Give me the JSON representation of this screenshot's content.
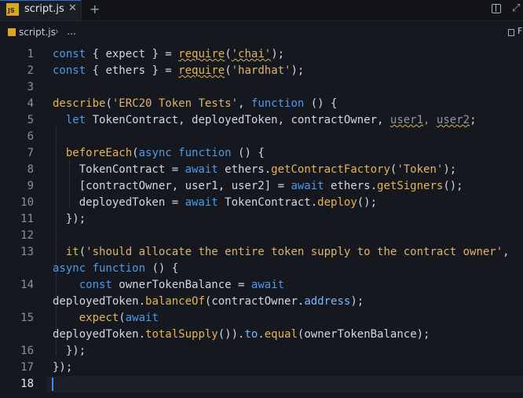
{
  "tab": {
    "icon": "JS",
    "filename": "script.js",
    "close": "✕"
  },
  "toolbar": {
    "new_tab": "+",
    "split_icon": "split-editor-icon",
    "expand": "⤢"
  },
  "breadcrumb": {
    "file": "script.js",
    "sep": "›",
    "more": "…",
    "right": "F"
  },
  "editor": {
    "active_line": 18,
    "lines": [
      {
        "n": "1",
        "t": [
          [
            "kw",
            "const"
          ],
          [
            "",
            "{ expect } = "
          ],
          [
            "fn squig",
            "require"
          ],
          [
            "",
            "("
          ],
          [
            "str squig",
            "'chai'"
          ],
          [
            "",
            ");"
          ]
        ]
      },
      {
        "n": "2",
        "t": [
          [
            "kw",
            "const"
          ],
          [
            "",
            "{ ethers } = "
          ],
          [
            "fn squig",
            "require"
          ],
          [
            "",
            "("
          ],
          [
            "str",
            "'hardhat'"
          ],
          [
            "",
            ");"
          ]
        ]
      },
      {
        "n": "3",
        "t": []
      },
      {
        "n": "4",
        "t": [
          [
            "fn",
            "describe"
          ],
          [
            "",
            "("
          ],
          [
            "str",
            "'ERC20 Token Tests'"
          ],
          [
            "",
            ", "
          ],
          [
            "kw",
            "function"
          ],
          [
            "",
            " () {"
          ]
        ]
      },
      {
        "n": "5",
        "t": [
          [
            "",
            "  "
          ],
          [
            "kw",
            "let"
          ],
          [
            "",
            " TokenContract, deployedToken, contractOwner, "
          ],
          [
            "dim squig",
            "user1"
          ],
          [
            "dim",
            ", "
          ],
          [
            "dim squig",
            "user2"
          ],
          [
            "",
            ";"
          ]
        ]
      },
      {
        "n": "6",
        "t": []
      },
      {
        "n": "7",
        "t": [
          [
            "",
            "  "
          ],
          [
            "fn",
            "beforeEach"
          ],
          [
            "",
            "("
          ],
          [
            "kw",
            "async function"
          ],
          [
            "",
            " () {"
          ]
        ]
      },
      {
        "n": "8",
        "t": [
          [
            "",
            "    TokenContract = "
          ],
          [
            "kw",
            "await"
          ],
          [
            "",
            " ethers."
          ],
          [
            "fn",
            "getContractFactory"
          ],
          [
            "",
            "("
          ],
          [
            "str",
            "'Token'"
          ],
          [
            "",
            ");"
          ]
        ]
      },
      {
        "n": "9",
        "t": [
          [
            "",
            "    [contractOwner, user1, user2] = "
          ],
          [
            "kw",
            "await"
          ],
          [
            "",
            " ethers."
          ],
          [
            "fn",
            "getSigners"
          ],
          [
            "",
            "();"
          ]
        ]
      },
      {
        "n": "10",
        "t": [
          [
            "",
            "    deployedToken = "
          ],
          [
            "kw",
            "await"
          ],
          [
            "",
            " TokenContract."
          ],
          [
            "fn",
            "deploy"
          ],
          [
            "",
            "();"
          ]
        ]
      },
      {
        "n": "11",
        "t": [
          [
            "",
            "  });"
          ]
        ]
      },
      {
        "n": "12",
        "t": []
      },
      {
        "n": "13",
        "t": [
          [
            "",
            "  "
          ],
          [
            "fn",
            "it"
          ],
          [
            "",
            "("
          ],
          [
            "str",
            "'should allocate the entire token supply to the contract owner'"
          ],
          [
            "",
            ","
          ]
        ]
      },
      {
        "n": "",
        "t": [
          [
            "kw",
            "async function"
          ],
          [
            "",
            " () {"
          ]
        ]
      },
      {
        "n": "14",
        "t": [
          [
            "",
            "    "
          ],
          [
            "kw",
            "const"
          ],
          [
            "",
            " ownerTokenBalance = "
          ],
          [
            "kw",
            "await"
          ]
        ]
      },
      {
        "n": "",
        "t": [
          [
            "",
            "deployedToken."
          ],
          [
            "fn",
            "balanceOf"
          ],
          [
            "",
            "(contractOwner."
          ],
          [
            "prop",
            "address"
          ],
          [
            "",
            ");"
          ]
        ]
      },
      {
        "n": "15",
        "t": [
          [
            "",
            "    "
          ],
          [
            "fn",
            "expect"
          ],
          [
            "",
            "("
          ],
          [
            "kw",
            "await"
          ]
        ]
      },
      {
        "n": "",
        "t": [
          [
            "",
            "deployedToken."
          ],
          [
            "fn",
            "totalSupply"
          ],
          [
            "",
            "())."
          ],
          [
            "prop",
            "to"
          ],
          [
            "",
            "."
          ],
          [
            "fn",
            "equal"
          ],
          [
            "",
            "(ownerTokenBalance);"
          ]
        ]
      },
      {
        "n": "16",
        "t": [
          [
            "",
            "  });"
          ]
        ]
      },
      {
        "n": "17",
        "t": [
          [
            "",
            "});"
          ]
        ]
      },
      {
        "n": "18",
        "t": []
      }
    ]
  }
}
